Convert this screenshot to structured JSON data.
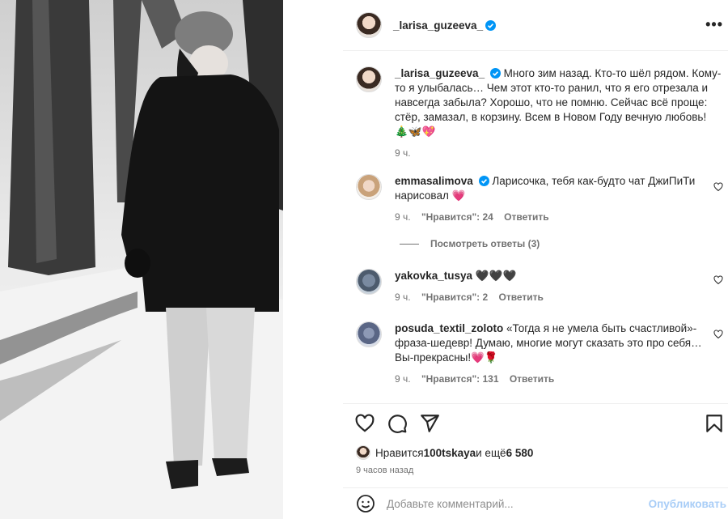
{
  "header": {
    "username": "_larisa_guzeeva_",
    "more_icon": "more-horizontal-icon"
  },
  "caption": {
    "username": "_larisa_guzeeva_",
    "text": "Много зим назад. Кто-то шёл рядом. Кому-то я улыбалась… Чем этот кто-то ранил, что я его отрезала и навсегда забыла? Хорошо, что не помню. Сейчас всё проще: стёр, замазал, в корзину. Всем в Новом Году вечную любовь! 🎄🦋💖",
    "time": "9 ч."
  },
  "comments": [
    {
      "username": "emmasalimova",
      "verified": true,
      "text": "Ларисочка, тебя как-будто чат ДжиПиТи нарисовал 💗",
      "time": "9 ч.",
      "likes": "\"Нравится\": 24",
      "reply": "Ответить",
      "view_replies": "Посмотреть ответы (3)"
    },
    {
      "username": "yakovka_tusya",
      "verified": false,
      "text": "🖤🖤🖤",
      "time": "9 ч.",
      "likes": "\"Нравится\": 2",
      "reply": "Ответить"
    },
    {
      "username": "posuda_textil_zoloto",
      "verified": false,
      "text": "«Тогда я не умела быть счастливой»- фраза-шедевр! Думаю, многие могут сказать это про себя… Вы-прекрасны!💗🌹",
      "time": "9 ч.",
      "likes": "\"Нравится\": 131",
      "reply": "Ответить"
    }
  ],
  "actions": {
    "like_icon": "heart-icon",
    "comment_icon": "comment-icon",
    "share_icon": "send-icon",
    "save_icon": "bookmark-icon"
  },
  "likes": {
    "prefix": "Нравится ",
    "user": "100tskaya",
    "middle": " и ещё ",
    "count": "6 580"
  },
  "posted": "9 часов назад",
  "add_comment": {
    "placeholder": "Добавьте комментарий...",
    "publish": "Опубликовать"
  },
  "colors": {
    "verified": "#0095f6",
    "publish_disabled": "#a8cdf7",
    "secondary_text": "#737373"
  }
}
